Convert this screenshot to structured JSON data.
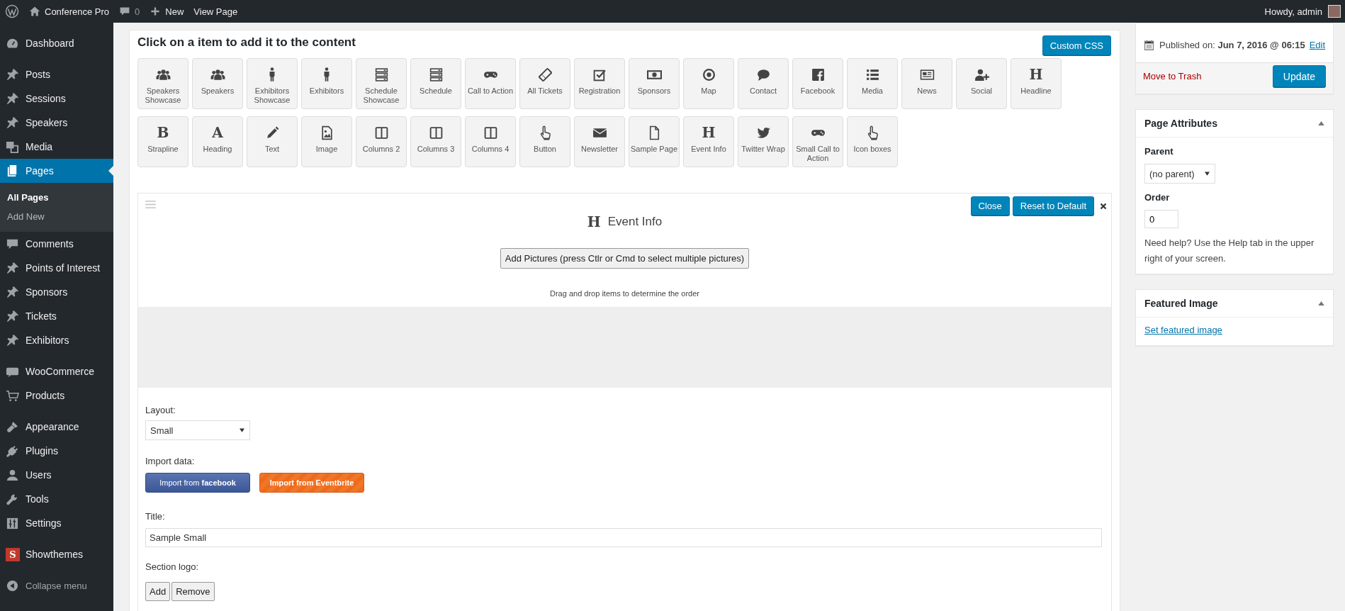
{
  "admin_bar": {
    "site": "Conference Pro",
    "comments": "0",
    "new": "New",
    "view": "View Page",
    "greeting": "Howdy, admin"
  },
  "sidebar": {
    "groups": [
      [
        {
          "label": "Dashboard",
          "selected": false
        }
      ],
      [
        {
          "label": "Posts",
          "selected": false
        },
        {
          "label": "Sessions",
          "selected": false
        },
        {
          "label": "Speakers",
          "selected": false
        },
        {
          "label": "Media",
          "selected": false
        },
        {
          "label": "Pages",
          "selected": true,
          "children": [
            {
              "label": "All Pages",
              "selected": true
            },
            {
              "label": "Add New",
              "selected": false
            }
          ]
        },
        {
          "label": "Comments",
          "selected": false
        },
        {
          "label": "Points of Interest",
          "selected": false
        },
        {
          "label": "Sponsors",
          "selected": false
        },
        {
          "label": "Tickets",
          "selected": false
        },
        {
          "label": "Exhibitors",
          "selected": false
        }
      ],
      [
        {
          "label": "WooCommerce",
          "selected": false
        },
        {
          "label": "Products",
          "selected": false
        }
      ],
      [
        {
          "label": "Appearance",
          "selected": false
        },
        {
          "label": "Plugins",
          "selected": false
        },
        {
          "label": "Users",
          "selected": false
        },
        {
          "label": "Tools",
          "selected": false
        },
        {
          "label": "Settings",
          "selected": false
        }
      ],
      [
        {
          "label": "Showthemes",
          "selected": false,
          "glyph": "S"
        }
      ]
    ],
    "collapse": "Collapse menu"
  },
  "builder": {
    "heading": "Click on a item to add it to the content",
    "custom_css": "Custom CSS",
    "items": [
      {
        "label": "Speakers Showcase"
      },
      {
        "label": "Speakers"
      },
      {
        "label": "Exhibitors Showcase"
      },
      {
        "label": "Exhibitors"
      },
      {
        "label": "Schedule Showcase"
      },
      {
        "label": "Schedule"
      },
      {
        "label": "Call to Action"
      },
      {
        "label": "All Tickets"
      },
      {
        "label": "Registration"
      },
      {
        "label": "Sponsors"
      },
      {
        "label": "Map"
      },
      {
        "label": "Contact"
      },
      {
        "label": "Facebook"
      },
      {
        "label": "Media"
      },
      {
        "label": "News"
      },
      {
        "label": "Social"
      },
      {
        "label": "Headline",
        "glyph": "H"
      },
      {
        "label": "Strapline",
        "glyph": "B"
      },
      {
        "label": "Heading",
        "glyph": "A"
      },
      {
        "label": "Text"
      },
      {
        "label": "Image"
      },
      {
        "label": "Columns 2"
      },
      {
        "label": "Columns 3"
      },
      {
        "label": "Columns 4"
      },
      {
        "label": "Button"
      },
      {
        "label": "Newsletter"
      },
      {
        "label": "Sample Page"
      },
      {
        "label": "Event Info",
        "glyph": "H"
      },
      {
        "label": "Twitter Wrap"
      },
      {
        "label": "Small Call to Action"
      },
      {
        "label": "Icon boxes"
      }
    ]
  },
  "section": {
    "glyph": "H",
    "title": "Event Info",
    "close": "Close",
    "reset": "Reset to Default",
    "add_pictures": "Add Pictures (press Ctlr or Cmd to select multiple pictures)",
    "drag_hint": "Drag and drop items to determine the order",
    "layout_label": "Layout:",
    "layout_value": "Small",
    "import_label": "Import data:",
    "import_facebook": "Import from **facebook**",
    "import_eventbrite": "Import from Eventbrite",
    "title_label": "Title:",
    "title_value": "Sample Small",
    "logo_label": "Section logo:",
    "logo_add": "Add",
    "logo_remove": "Remove"
  },
  "publish": {
    "published": "Published on: **Jun 7, 2016 @ 06:15**",
    "edit": "Edit",
    "trash": "Move to Trash",
    "update": "Update"
  },
  "page_attributes": {
    "title": "Page Attributes",
    "parent_label": "Parent",
    "parent_value": "(no parent)",
    "order_label": "Order",
    "order_value": "0",
    "help": "Need help? Use the Help tab in the upper right of your screen."
  },
  "featured_image": {
    "title": "Featured Image",
    "link": "Set featured image"
  }
}
